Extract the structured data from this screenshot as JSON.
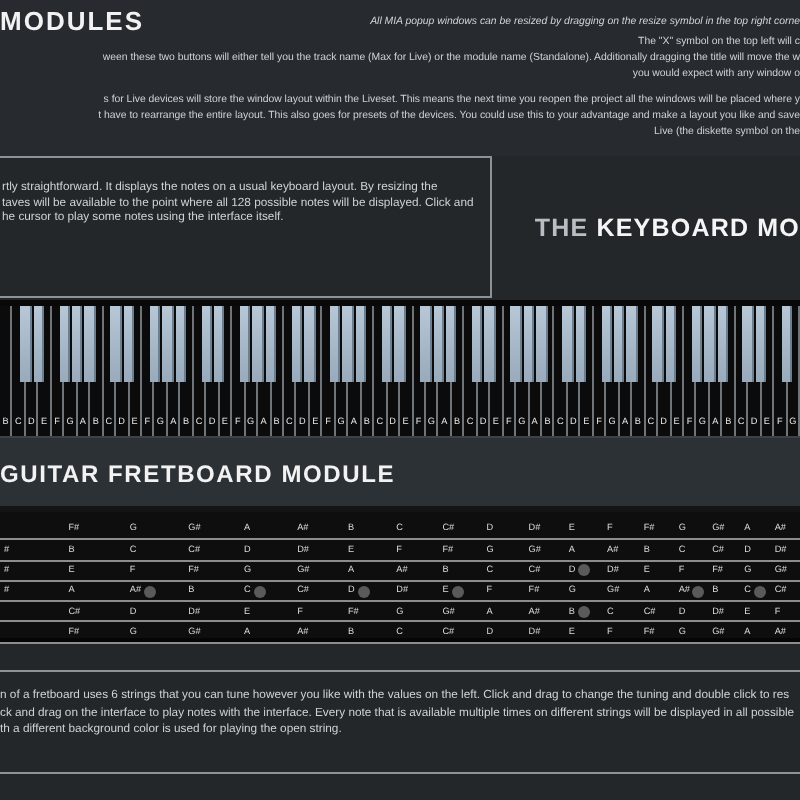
{
  "header": {
    "title": "MODULES",
    "paragraphs": [
      {
        "lines": [
          {
            "text": "All MIA popup windows can be resized by dragging on the resize symbol in the top right corne",
            "italic": true
          },
          {
            "text": "The \"X\" symbol on the top left will c",
            "italic": false
          },
          {
            "text": "ween these two buttons will either tell you the track name (Max for Live) or the module name (Standalone). Additionally dragging the title will move the w",
            "italic": false
          },
          {
            "text": "you would expect with any window o",
            "italic": false
          }
        ]
      },
      {
        "lines": [
          {
            "text": "s for Live devices will store the window layout within the Liveset. This means the next time you reopen the project all the windows will be placed where y",
            "italic": false
          },
          {
            "text": "t have to rearrange the entire layout. This also goes for presets of the devices. You could use this to your advantage and make a layout you like and save",
            "italic": false
          },
          {
            "text": "Live (the diskette symbol on the",
            "italic": false
          }
        ]
      }
    ]
  },
  "keyboard_section": {
    "intro_lines": [
      "rtly straightforward. It displays the notes on a usual keyboard layout. By resizing the",
      "taves will be available to the point where all 128 possible notes will be displayed. Click and",
      "he cursor to play some notes using the interface itself."
    ],
    "title_prefix": "THE",
    "title": "KEYBOARD MO"
  },
  "keyboard": {
    "white_keys": [
      {
        "label": "B",
        "black_after": false
      },
      {
        "label": "C",
        "black_after": true
      },
      {
        "label": "D",
        "black_after": true
      },
      {
        "label": "E",
        "black_after": false
      },
      {
        "label": "F",
        "black_after": true
      },
      {
        "label": "G",
        "black_after": true
      },
      {
        "label": "A",
        "black_after": true
      },
      {
        "label": "B",
        "black_after": false
      },
      {
        "label": "C",
        "black_after": true
      },
      {
        "label": "D",
        "black_after": true
      },
      {
        "label": "E",
        "black_after": false
      },
      {
        "label": "F",
        "black_after": true
      },
      {
        "label": "G",
        "black_after": true
      },
      {
        "label": "A",
        "black_after": true
      },
      {
        "label": "B",
        "black_after": false
      },
      {
        "label": "C",
        "black_after": true
      },
      {
        "label": "D",
        "black_after": true
      },
      {
        "label": "E",
        "black_after": false
      },
      {
        "label": "F",
        "black_after": true
      },
      {
        "label": "G",
        "black_after": true
      },
      {
        "label": "A",
        "black_after": true
      },
      {
        "label": "B",
        "black_after": false
      },
      {
        "label": "C",
        "black_after": true
      },
      {
        "label": "D",
        "black_after": true
      },
      {
        "label": "E",
        "black_after": false
      },
      {
        "label": "F",
        "black_after": true
      },
      {
        "label": "G",
        "black_after": true
      },
      {
        "label": "A",
        "black_after": true
      },
      {
        "label": "B",
        "black_after": false
      },
      {
        "label": "C",
        "black_after": true
      },
      {
        "label": "D",
        "black_after": true
      },
      {
        "label": "E",
        "black_after": false
      },
      {
        "label": "F",
        "black_after": true
      },
      {
        "label": "G",
        "black_after": true
      },
      {
        "label": "A",
        "black_after": true
      },
      {
        "label": "B",
        "black_after": false
      },
      {
        "label": "C",
        "black_after": true
      },
      {
        "label": "D",
        "black_after": true
      },
      {
        "label": "E",
        "black_after": false
      },
      {
        "label": "F",
        "black_after": true
      },
      {
        "label": "G",
        "black_after": true
      },
      {
        "label": "A",
        "black_after": true
      },
      {
        "label": "B",
        "black_after": false
      },
      {
        "label": "C",
        "black_after": true
      },
      {
        "label": "D",
        "black_after": true
      },
      {
        "label": "E",
        "black_after": false
      },
      {
        "label": "F",
        "black_after": true
      },
      {
        "label": "G",
        "black_after": true
      },
      {
        "label": "A",
        "black_after": true
      },
      {
        "label": "B",
        "black_after": false
      },
      {
        "label": "C",
        "black_after": true
      },
      {
        "label": "D",
        "black_after": true
      },
      {
        "label": "E",
        "black_after": false
      },
      {
        "label": "F",
        "black_after": true
      },
      {
        "label": "G",
        "black_after": true
      },
      {
        "label": "A",
        "black_after": true
      },
      {
        "label": "B",
        "black_after": false
      },
      {
        "label": "C",
        "black_after": true
      },
      {
        "label": "D",
        "black_after": true
      },
      {
        "label": "E",
        "black_after": false
      },
      {
        "label": "F",
        "black_after": true
      },
      {
        "label": "G",
        "black_after": false
      }
    ]
  },
  "fretboard": {
    "title": "GUITAR FRETBOARD MODULE",
    "strings": [
      {
        "frets": [
          {
            "dot": false
          },
          {
            "note": "F#",
            "dot": false
          },
          {
            "note": "G",
            "dot": false
          },
          {
            "note": "G#",
            "dot": false
          },
          {
            "note": "A",
            "dot": false
          },
          {
            "note": "A#",
            "dot": false
          },
          {
            "note": "B",
            "dot": false
          },
          {
            "note": "C",
            "dot": false
          },
          {
            "note": "C#",
            "dot": false
          },
          {
            "note": "D",
            "dot": false
          },
          {
            "note": "D#",
            "dot": false
          },
          {
            "note": "E",
            "dot": false
          },
          {
            "note": "F",
            "dot": false
          },
          {
            "note": "F#",
            "dot": false
          },
          {
            "note": "G",
            "dot": false
          },
          {
            "note": "G#",
            "dot": false
          },
          {
            "note": "A",
            "dot": false
          },
          {
            "note": "A#",
            "dot": false
          }
        ]
      },
      {
        "frets": [
          {
            "note": "#",
            "dot": false
          },
          {
            "note": "B",
            "dot": false
          },
          {
            "note": "C",
            "dot": false
          },
          {
            "note": "C#",
            "dot": false
          },
          {
            "note": "D",
            "dot": false
          },
          {
            "note": "D#",
            "dot": false
          },
          {
            "note": "E",
            "dot": false
          },
          {
            "note": "F",
            "dot": false
          },
          {
            "note": "F#",
            "dot": false
          },
          {
            "note": "G",
            "dot": false
          },
          {
            "note": "G#",
            "dot": false
          },
          {
            "note": "A",
            "dot": false
          },
          {
            "note": "A#",
            "dot": false
          },
          {
            "note": "B",
            "dot": false
          },
          {
            "note": "C",
            "dot": false
          },
          {
            "note": "C#",
            "dot": false
          },
          {
            "note": "D",
            "dot": false
          },
          {
            "note": "D#",
            "dot": false
          }
        ]
      },
      {
        "frets": [
          {
            "note": "#",
            "dot": false
          },
          {
            "note": "E",
            "dot": false
          },
          {
            "note": "F",
            "dot": false
          },
          {
            "note": "F#",
            "dot": false
          },
          {
            "note": "G",
            "dot": false
          },
          {
            "note": "G#",
            "dot": false
          },
          {
            "note": "A",
            "dot": false
          },
          {
            "note": "A#",
            "dot": false
          },
          {
            "note": "B",
            "dot": false
          },
          {
            "note": "C",
            "dot": false
          },
          {
            "note": "C#",
            "dot": false
          },
          {
            "note": "D",
            "dot": true
          },
          {
            "note": "D#",
            "dot": false
          },
          {
            "note": "E",
            "dot": false
          },
          {
            "note": "F",
            "dot": false
          },
          {
            "note": "F#",
            "dot": false
          },
          {
            "note": "G",
            "dot": false
          },
          {
            "note": "G#",
            "dot": false
          }
        ]
      },
      {
        "frets": [
          {
            "note": "#",
            "dot": false
          },
          {
            "note": "A",
            "dot": false
          },
          {
            "note": "A#",
            "dot": true
          },
          {
            "note": "B",
            "dot": false
          },
          {
            "note": "C",
            "dot": true
          },
          {
            "note": "C#",
            "dot": false
          },
          {
            "note": "D",
            "dot": true
          },
          {
            "note": "D#",
            "dot": false
          },
          {
            "note": "E",
            "dot": true
          },
          {
            "note": "F",
            "dot": false
          },
          {
            "note": "F#",
            "dot": false
          },
          {
            "note": "G",
            "dot": false
          },
          {
            "note": "G#",
            "dot": false
          },
          {
            "note": "A",
            "dot": false
          },
          {
            "note": "A#",
            "dot": true
          },
          {
            "note": "B",
            "dot": false
          },
          {
            "note": "C",
            "dot": true
          },
          {
            "note": "C#",
            "dot": false
          }
        ]
      },
      {
        "frets": [
          {
            "dot": false
          },
          {
            "note": "C#",
            "dot": false
          },
          {
            "note": "D",
            "dot": false
          },
          {
            "note": "D#",
            "dot": false
          },
          {
            "note": "E",
            "dot": false
          },
          {
            "note": "F",
            "dot": false
          },
          {
            "note": "F#",
            "dot": false
          },
          {
            "note": "G",
            "dot": false
          },
          {
            "note": "G#",
            "dot": false
          },
          {
            "note": "A",
            "dot": false
          },
          {
            "note": "A#",
            "dot": false
          },
          {
            "note": "B",
            "dot": true
          },
          {
            "note": "C",
            "dot": false
          },
          {
            "note": "C#",
            "dot": false
          },
          {
            "note": "D",
            "dot": false
          },
          {
            "note": "D#",
            "dot": false
          },
          {
            "note": "E",
            "dot": false
          },
          {
            "note": "F",
            "dot": false
          }
        ]
      },
      {
        "frets": [
          {
            "dot": false
          },
          {
            "note": "F#",
            "dot": false
          },
          {
            "note": "G",
            "dot": false
          },
          {
            "note": "G#",
            "dot": false
          },
          {
            "note": "A",
            "dot": false
          },
          {
            "note": "A#",
            "dot": false
          },
          {
            "note": "B",
            "dot": false
          },
          {
            "note": "C",
            "dot": false
          },
          {
            "note": "C#",
            "dot": false
          },
          {
            "note": "D",
            "dot": false
          },
          {
            "note": "D#",
            "dot": false
          },
          {
            "note": "E",
            "dot": false
          },
          {
            "note": "F",
            "dot": false
          },
          {
            "note": "F#",
            "dot": false
          },
          {
            "note": "G",
            "dot": false
          },
          {
            "note": "G#",
            "dot": false
          },
          {
            "note": "A",
            "dot": false
          },
          {
            "note": "A#",
            "dot": false
          }
        ]
      }
    ]
  },
  "description_lines": [
    "n of a fretboard uses 6 strings that you can tune however you like with the values on the left. Click and drag to change the tuning and double click to res",
    "ck and drag on the interface to play notes with the interface. Every note that is available multiple times on different strings will be displayed in all possible",
    "th a different background color is used for playing the open string."
  ]
}
